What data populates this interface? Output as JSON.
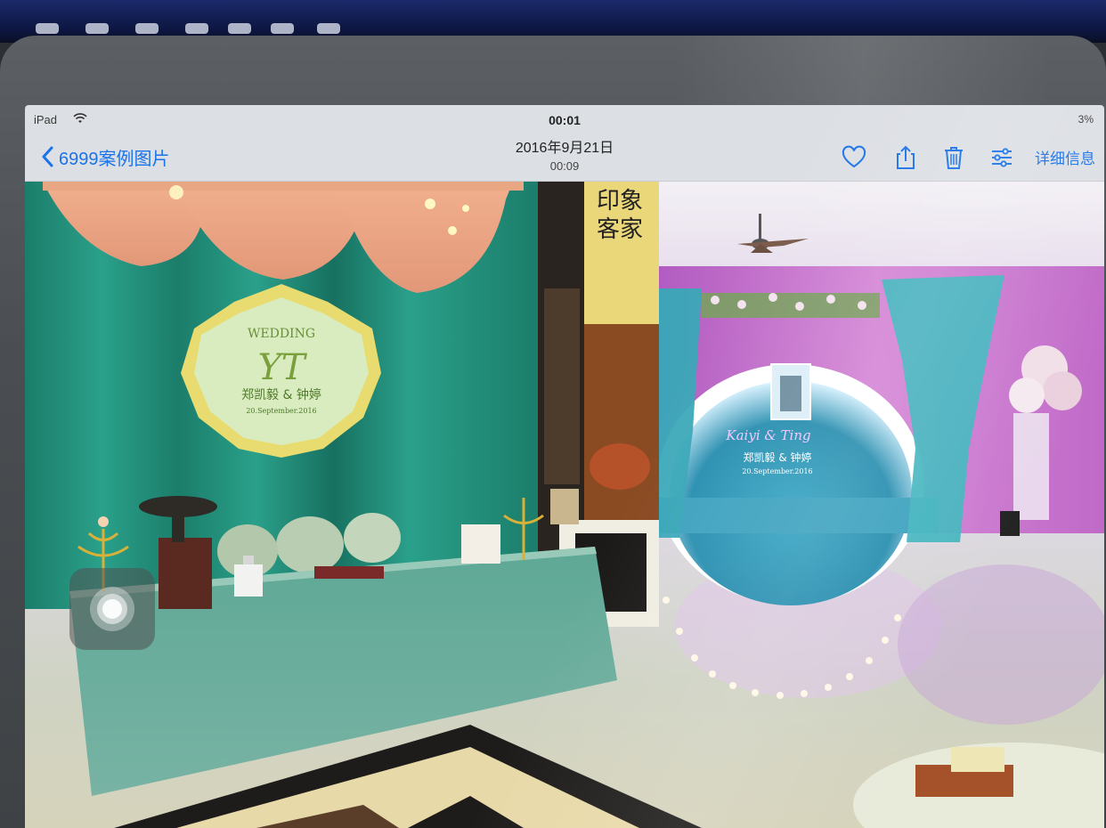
{
  "status_bar": {
    "device": "iPad",
    "clock": "00:01",
    "battery": "3%"
  },
  "nav": {
    "back_label": "6999案例图片",
    "date": "2016年9月21日",
    "time": "00:09",
    "details_label": "详细信息",
    "icons": [
      "wifi-icon",
      "chevron-left-icon",
      "heart-icon",
      "share-icon",
      "trash-icon",
      "sliders-icon"
    ]
  },
  "photo": {
    "pillar_sign": "印象\n客家",
    "left_emblem_wedding": "WEDDING",
    "left_emblem_monogram": "YT",
    "left_emblem_names": "郑凯毅 & 钟婷",
    "left_emblem_date": "20.September.2016",
    "right_backdrop_script": "Kaiyi & Ting",
    "right_backdrop_names": "郑凯毅 & 钟婷",
    "right_backdrop_date": "20.September.2016"
  },
  "colors": {
    "ios_blue": "#1b73e8",
    "teal_curtain": "#1d8c78",
    "pink_wall": "#c86ac8",
    "floor": "#d9d6c8"
  }
}
